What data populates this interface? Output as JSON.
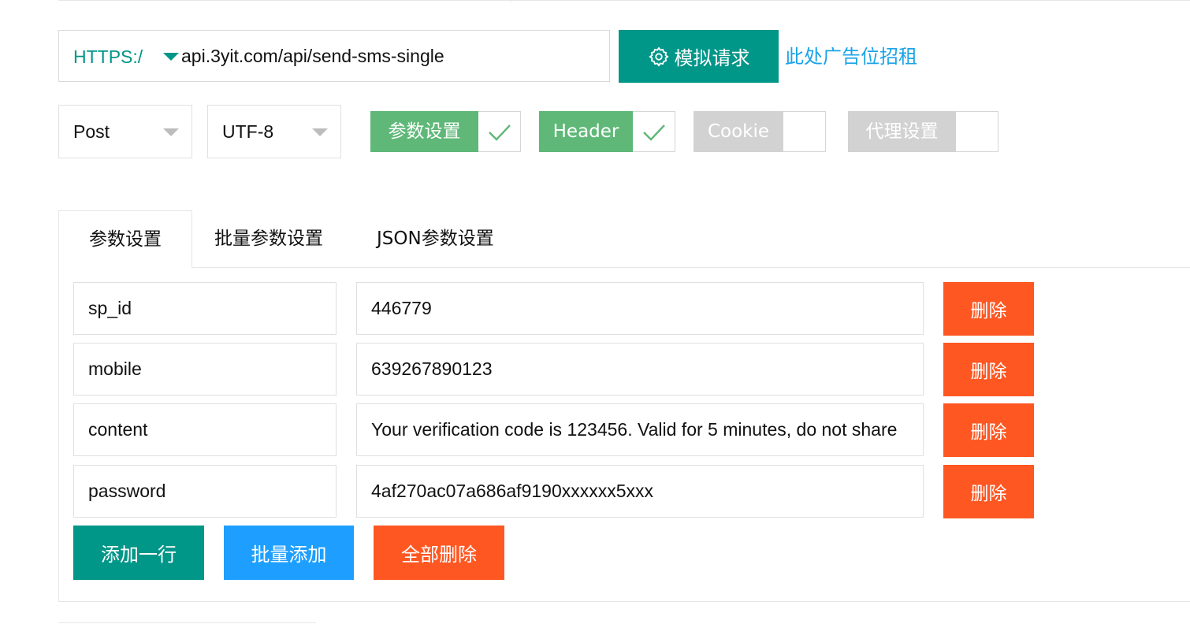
{
  "request": {
    "protocol": "HTTPS:/",
    "url": "api.3yit.com/api/send-sms-single",
    "simulate_label": "模拟请求",
    "ad_text": "此处广告位招租"
  },
  "options": {
    "method": "Post",
    "charset": "UTF-8",
    "toggles": [
      {
        "label": "参数设置",
        "enabled": true
      },
      {
        "label": "Header",
        "enabled": true
      },
      {
        "label": "Cookie",
        "enabled": false
      },
      {
        "label": "代理设置",
        "enabled": false
      }
    ]
  },
  "tabs": [
    {
      "label": "参数设置",
      "active": true
    },
    {
      "label": "批量参数设置",
      "active": false
    },
    {
      "label": "JSON参数设置",
      "active": false
    }
  ],
  "params": [
    {
      "key": "sp_id",
      "value": "446779",
      "delete_label": "删除"
    },
    {
      "key": "mobile",
      "value": "639267890123",
      "delete_label": "删除"
    },
    {
      "key": "content",
      "value": "Your verification code is 123456. Valid for 5 minutes, do not share",
      "delete_label": "删除"
    },
    {
      "key": "password",
      "value": "4af270ac07a686af9190xxxxxx5xxx",
      "delete_label": "删除"
    }
  ],
  "actions": {
    "add_row": "添加一行",
    "batch_add": "批量添加",
    "delete_all": "全部删除"
  },
  "colors": {
    "primary": "#009688",
    "toggle_on": "#5fb878",
    "toggle_off": "#d2d2d2",
    "danger": "#ff5722",
    "info": "#1e9fff",
    "link": "#1aa3e8"
  },
  "icons": {
    "simulate": "gear-icon",
    "toggle_on": "check-icon"
  }
}
